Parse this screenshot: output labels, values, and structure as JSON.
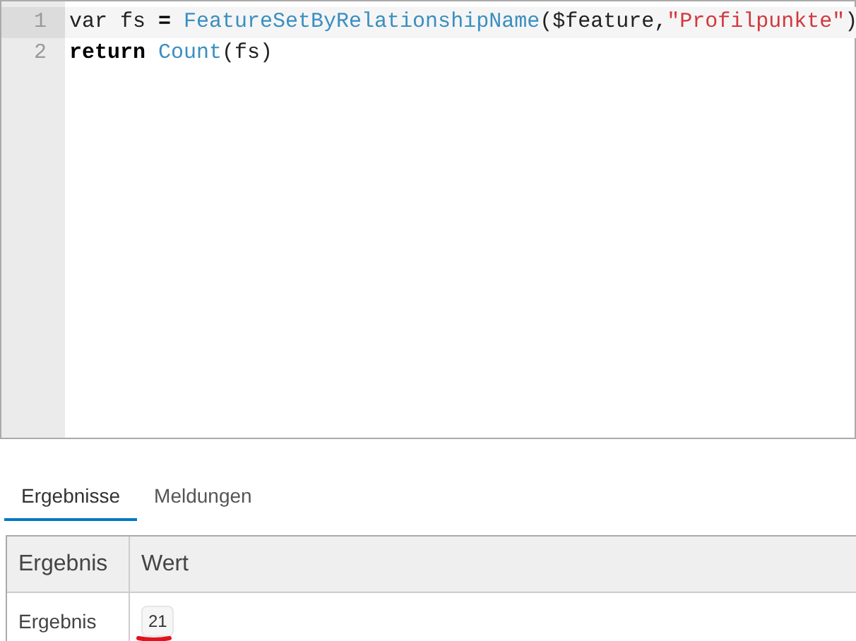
{
  "editor": {
    "lines": [
      {
        "number": "1",
        "active": true,
        "tokens": [
          {
            "kind": "plain",
            "text": "var fs "
          },
          {
            "kind": "keyword",
            "text": "="
          },
          {
            "kind": "function",
            "text": " FeatureSetByRelationshipName"
          },
          {
            "kind": "plain",
            "text": "($feature,"
          },
          {
            "kind": "string",
            "text": "\"Profilpunkte\""
          },
          {
            "kind": "plain",
            "text": ")"
          }
        ]
      },
      {
        "number": "2",
        "active": false,
        "tokens": [
          {
            "kind": "keyword",
            "text": "return"
          },
          {
            "kind": "function",
            "text": " Count"
          },
          {
            "kind": "plain",
            "text": "(fs)"
          }
        ]
      }
    ]
  },
  "tabs": [
    {
      "label": "Ergebnisse",
      "selected": true
    },
    {
      "label": "Meldungen",
      "selected": false
    }
  ],
  "table": {
    "columns": [
      "Ergebnis",
      "Wert"
    ],
    "rows": [
      {
        "label": "Ergebnis",
        "value": "21"
      }
    ]
  }
}
